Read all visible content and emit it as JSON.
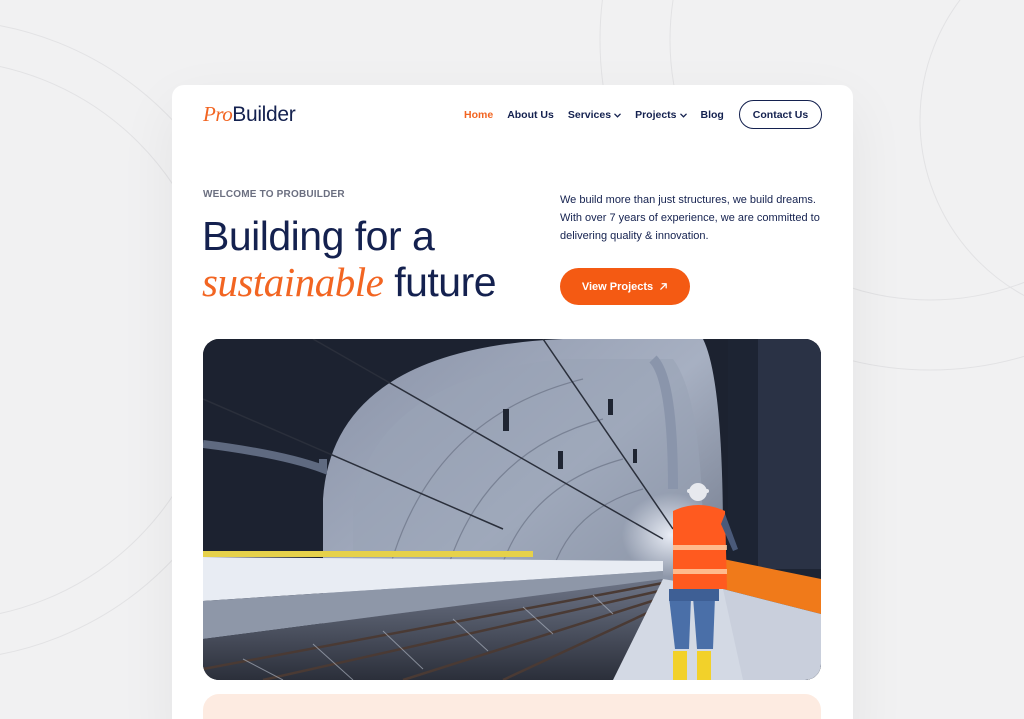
{
  "brand": {
    "logo_pro": "Pro",
    "logo_builder": "Builder"
  },
  "nav": {
    "items": [
      {
        "label": "Home",
        "active": true,
        "dropdown": false
      },
      {
        "label": "About Us",
        "active": false,
        "dropdown": false
      },
      {
        "label": "Services",
        "active": false,
        "dropdown": true
      },
      {
        "label": "Projects",
        "active": false,
        "dropdown": true
      },
      {
        "label": "Blog",
        "active": false,
        "dropdown": false
      }
    ],
    "contact_label": "Contact Us"
  },
  "hero": {
    "eyebrow": "WELCOME TO PROBUILDER",
    "headline_part1": "Building for a",
    "headline_emphasis": "sustainable",
    "headline_part2": "future",
    "intro": "We build more than just structures, we build dreams. With over 7 years of experience, we are committed to delivering quality & innovation.",
    "cta_label": "View Projects",
    "cta_icon": "arrow-up-right-icon",
    "image": "tunnel-construction-worker-photo"
  },
  "colors": {
    "accent": "#f26522",
    "navy": "#14214f",
    "background": "#f1f1f2",
    "peach": "#fdebe1"
  }
}
